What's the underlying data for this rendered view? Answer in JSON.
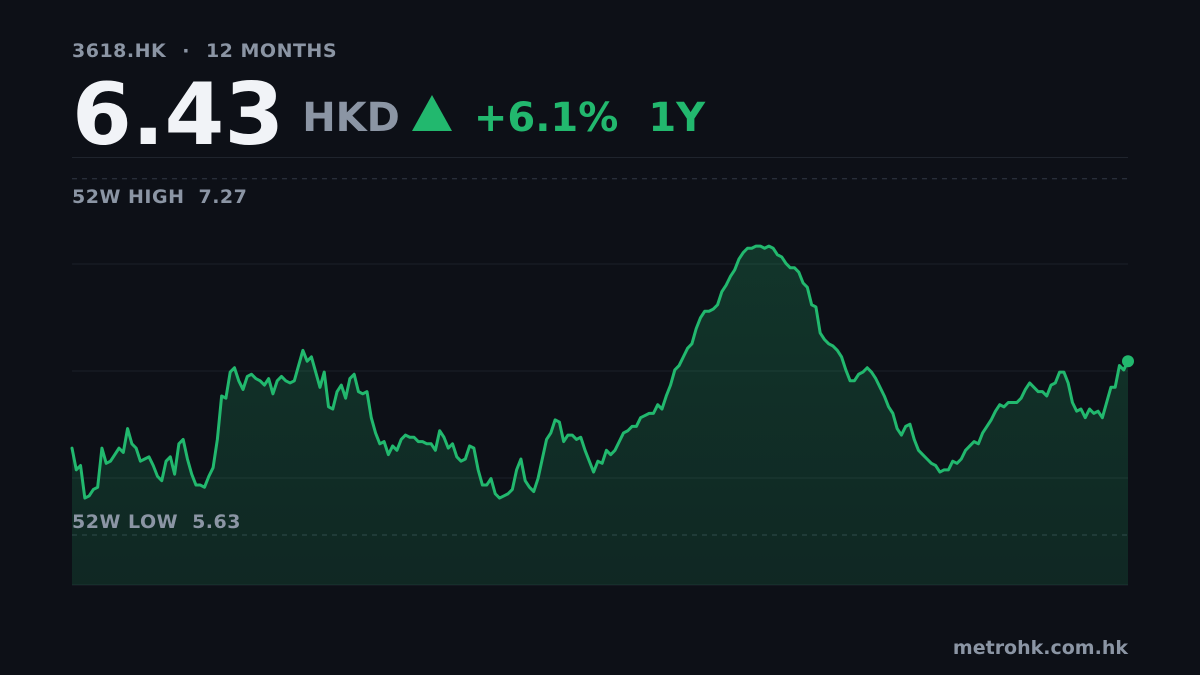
{
  "header": {
    "ticker": "3618.HK",
    "separator": "·",
    "range_label": "12 MONTHS",
    "price": "6.43",
    "currency": "HKD",
    "change": "+6.1%",
    "period": "1Y"
  },
  "colors": {
    "background": "#0d1017",
    "up": "#22b86e",
    "muted": "#8b95a4",
    "price": "#f1f3f7"
  },
  "chart_data": {
    "type": "area",
    "ylim": [
      5.4,
      7.37
    ],
    "grid": true,
    "reference_lines": [
      {
        "name": "52W HIGH",
        "value": "7.27",
        "y": 7.27
      },
      {
        "name": "52W LOW",
        "value": "5.63",
        "y": 5.63
      }
    ],
    "series": [
      {
        "values": [
          6.03,
          5.93,
          5.95,
          5.8,
          5.81,
          5.84,
          5.85,
          6.03,
          5.96,
          5.97,
          6.0,
          6.03,
          6.01,
          6.12,
          6.05,
          6.03,
          5.97,
          5.98,
          5.99,
          5.95,
          5.9,
          5.88,
          5.97,
          5.99,
          5.91,
          6.05,
          6.07,
          5.98,
          5.91,
          5.86,
          5.86,
          5.85,
          5.9,
          5.94,
          6.07,
          6.27,
          6.26,
          6.38,
          6.4,
          6.34,
          6.3,
          6.36,
          6.37,
          6.35,
          6.34,
          6.32,
          6.35,
          6.28,
          6.34,
          6.36,
          6.34,
          6.33,
          6.34,
          6.41,
          6.48,
          6.43,
          6.45,
          6.38,
          6.31,
          6.38,
          6.22,
          6.21,
          6.29,
          6.32,
          6.26,
          6.35,
          6.37,
          6.29,
          6.28,
          6.29,
          6.17,
          6.1,
          6.05,
          6.06,
          6.0,
          6.04,
          6.02,
          6.07,
          6.09,
          6.08,
          6.08,
          6.06,
          6.06,
          6.05,
          6.05,
          6.02,
          6.11,
          6.08,
          6.03,
          6.05,
          5.99,
          5.97,
          5.98,
          6.04,
          6.03,
          5.93,
          5.86,
          5.86,
          5.89,
          5.82,
          5.8,
          5.81,
          5.82,
          5.84,
          5.93,
          5.98,
          5.88,
          5.85,
          5.83,
          5.89,
          5.98,
          6.07,
          6.1,
          6.16,
          6.15,
          6.06,
          6.09,
          6.09,
          6.07,
          6.08,
          6.02,
          5.97,
          5.92,
          5.97,
          5.96,
          6.02,
          6.0,
          6.02,
          6.06,
          6.1,
          6.11,
          6.13,
          6.13,
          6.17,
          6.18,
          6.19,
          6.19,
          6.23,
          6.21,
          6.27,
          6.32,
          6.39,
          6.41,
          6.45,
          6.49,
          6.51,
          6.58,
          6.63,
          6.66,
          6.66,
          6.67,
          6.69,
          6.75,
          6.78,
          6.82,
          6.85,
          6.9,
          6.93,
          6.95,
          6.95,
          6.96,
          6.96,
          6.95,
          6.96,
          6.95,
          6.92,
          6.91,
          6.88,
          6.86,
          6.86,
          6.84,
          6.79,
          6.77,
          6.69,
          6.68,
          6.56,
          6.53,
          6.51,
          6.5,
          6.48,
          6.45,
          6.39,
          6.34,
          6.34,
          6.37,
          6.38,
          6.4,
          6.38,
          6.35,
          6.31,
          6.27,
          6.22,
          6.19,
          6.12,
          6.09,
          6.13,
          6.14,
          6.07,
          6.02,
          6.0,
          5.98,
          5.96,
          5.95,
          5.92,
          5.93,
          5.93,
          5.97,
          5.96,
          5.98,
          6.02,
          6.04,
          6.06,
          6.05,
          6.1,
          6.13,
          6.16,
          6.2,
          6.23,
          6.22,
          6.24,
          6.24,
          6.24,
          6.26,
          6.3,
          6.33,
          6.31,
          6.29,
          6.29,
          6.27,
          6.32,
          6.33,
          6.38,
          6.38,
          6.33,
          6.24,
          6.2,
          6.21,
          6.17,
          6.21,
          6.19,
          6.2,
          6.17,
          6.24,
          6.31,
          6.31,
          6.41,
          6.39,
          6.43
        ],
        "color": "#22b86e"
      }
    ]
  },
  "footer": {
    "site": "metrohk.com.hk"
  }
}
